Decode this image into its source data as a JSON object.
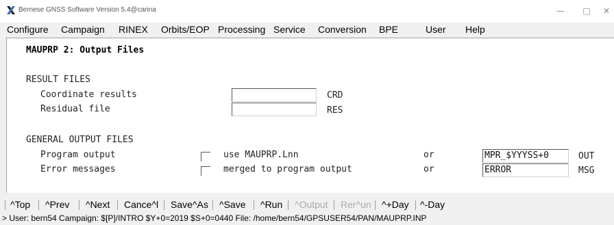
{
  "window": {
    "title": "Bernese GNSS Software Version 5.4@carina",
    "minimize": "—",
    "maximize": "□",
    "close": "✕"
  },
  "menu": {
    "items": [
      {
        "label": "Configure"
      },
      {
        "label": "Campaign"
      },
      {
        "label": "RINEX"
      },
      {
        "label": "Orbits/EOP"
      },
      {
        "label": "Processing"
      },
      {
        "label": "Service"
      },
      {
        "label": "Conversion"
      },
      {
        "label": "BPE"
      },
      {
        "label": "User"
      },
      {
        "label": "Help"
      }
    ]
  },
  "panel": {
    "title": "MAUPRP 2: Output Files",
    "result_files": {
      "heading": "RESULT FILES",
      "rows": [
        {
          "label": "Coordinate results",
          "value": "",
          "ext": "CRD"
        },
        {
          "label": "Residual file",
          "value": "",
          "ext": "RES"
        }
      ]
    },
    "general_output": {
      "heading": "GENERAL OUTPUT FILES",
      "rows": [
        {
          "label": "Program output",
          "checked": false,
          "option": "use MAUPRP.Lnn",
          "or": "or",
          "value": "MPR_$YYYSS+0",
          "ext": "OUT"
        },
        {
          "label": "Error messages",
          "checked": false,
          "option": "merged to program output",
          "or": "or",
          "value": "ERROR",
          "ext": "MSG"
        }
      ]
    }
  },
  "buttons": [
    {
      "label": "^Top",
      "enabled": true
    },
    {
      "label": "^Prev",
      "enabled": true
    },
    {
      "label": "^Next",
      "enabled": true
    },
    {
      "label": "Cance^l",
      "enabled": true
    },
    {
      "label": "Save^As",
      "enabled": true
    },
    {
      "label": "^Save",
      "enabled": true
    },
    {
      "label": "^Run",
      "enabled": true
    },
    {
      "label": "^Output",
      "enabled": false
    },
    {
      "label": "Rer^un",
      "enabled": false
    },
    {
      "label": "^+Day",
      "enabled": true
    },
    {
      "label": "^-Day",
      "enabled": true
    }
  ],
  "status": "> User: bern54  Campaign: $[P]/INTRO  $Y+0=2019  $S+0=0440  File: /home/bern54/GPSUSER54/PAN/MAUPRP.INP"
}
